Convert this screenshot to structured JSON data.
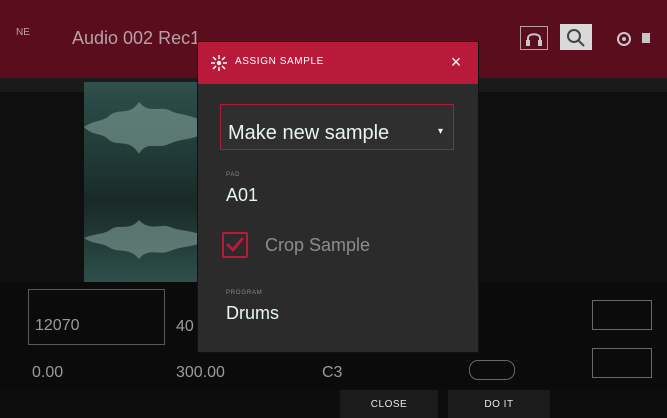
{
  "header": {
    "track_title": "Audio 002 Rec1"
  },
  "values": {
    "left_box": "12070",
    "left_box_suffix": "40",
    "start": "0.00",
    "length": "300.00",
    "note": "C3"
  },
  "modal": {
    "title": "ASSIGN SAMPLE",
    "close_symbol": "×",
    "select": {
      "value": "Make new sample",
      "arrow": "▾"
    },
    "pad": {
      "label": "PAD",
      "value": "A01"
    },
    "crop": {
      "checked": true,
      "label": "Crop Sample"
    },
    "program": {
      "label": "PROGRAM",
      "value": "Drums"
    }
  },
  "footer": {
    "close_label": "CLOSE",
    "doit_label": "DO IT"
  },
  "icons": [
    "burst-icon",
    "close-icon",
    "headphones-icon",
    "zoom-icon",
    "gear-icon",
    "menu-dot-icon",
    "link-icon"
  ],
  "colors": {
    "accent": "#b91a3a",
    "modal_bg": "#2b2b2b",
    "header_bg": "#5a0e1d",
    "text": "#e7f6ec"
  }
}
